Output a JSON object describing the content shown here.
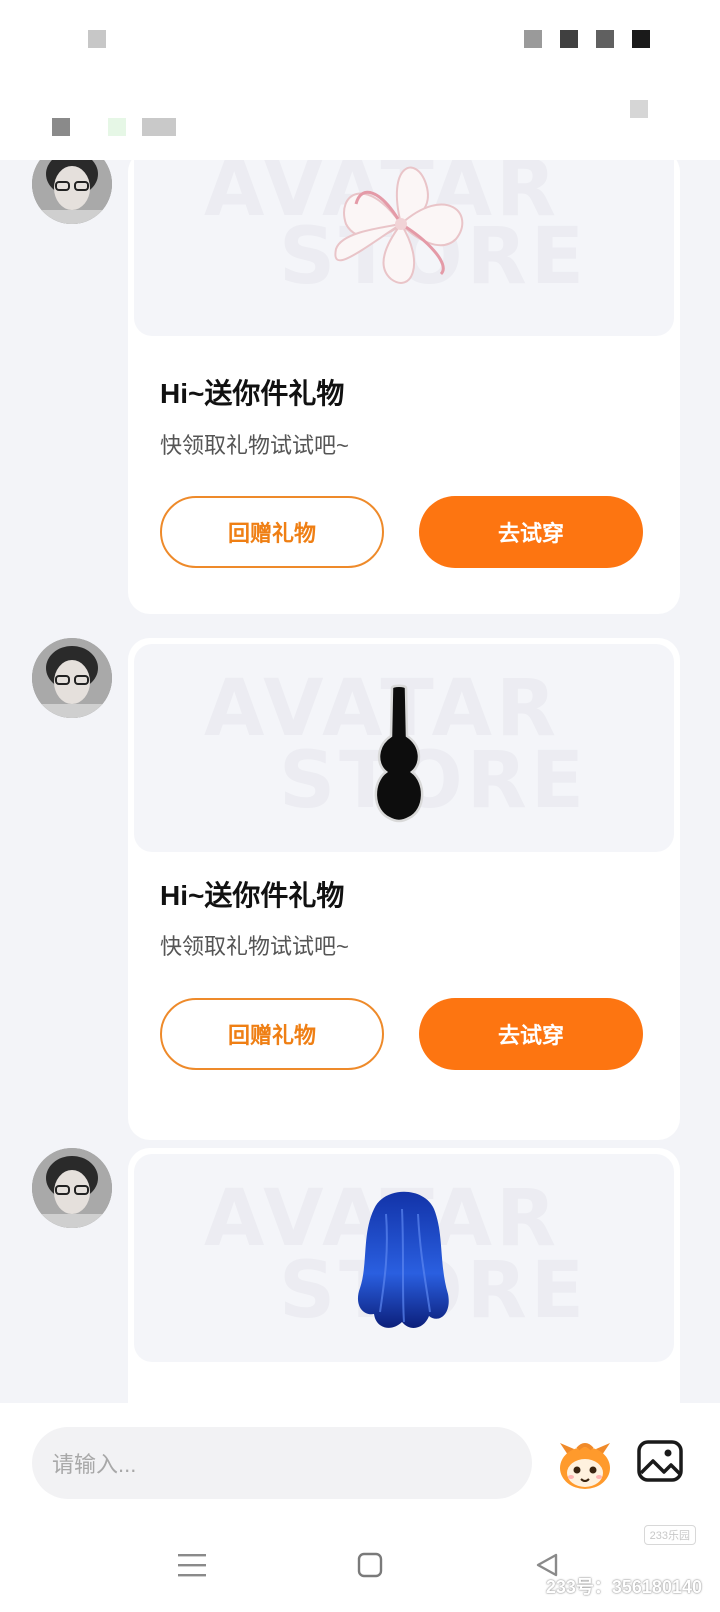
{
  "gift_cards": [
    {
      "item": "flower-hair-accessory",
      "watermark_line1": "AVATAR",
      "watermark_line2": "STORE",
      "title": "Hi~送你件礼物",
      "subtitle": "快领取礼物试试吧~",
      "return_gift_label": "回赠礼物",
      "try_on_label": "去试穿"
    },
    {
      "item": "guitar-case",
      "watermark_line1": "AVATAR",
      "watermark_line2": "STORE",
      "title": "Hi~送你件礼物",
      "subtitle": "快领取礼物试试吧~",
      "return_gift_label": "回赠礼物",
      "try_on_label": "去试穿"
    },
    {
      "item": "blue-long-hair",
      "watermark_line1": "AVATAR",
      "watermark_line2": "STORE"
    }
  ],
  "input": {
    "placeholder": "请输入..."
  },
  "icons": {
    "emoji": "mascot-emoji-icon",
    "image": "image-picker-icon",
    "nav_menu": "menu-icon",
    "nav_home": "home-square-icon",
    "nav_back": "back-triangle-icon"
  },
  "watermark": {
    "badge": "233乐园",
    "id": "233号：356180140"
  },
  "colors": {
    "accent": "#fd7511",
    "outline": "#ee8a2a",
    "background": "#f3f4f8"
  }
}
